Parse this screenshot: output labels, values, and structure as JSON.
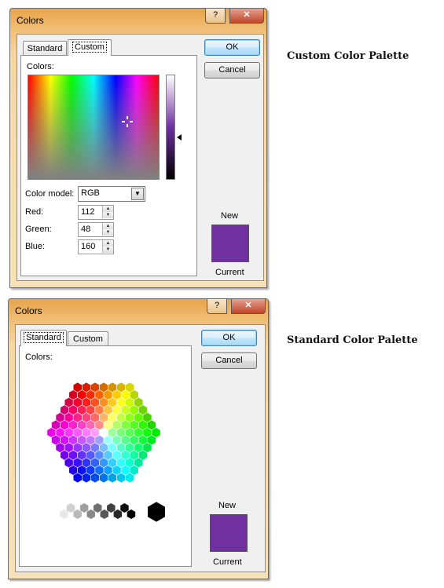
{
  "custom_dialog": {
    "title": "Colors",
    "help_label": "?",
    "close_label": "✕",
    "tabs": [
      {
        "label": "Standard"
      },
      {
        "label": "Custom"
      }
    ],
    "active_tab": "Custom",
    "colors_label": "Colors:",
    "color_model_label": "Color model:",
    "color_model_value": "RGB",
    "red_label": "Red:",
    "red_value": "112",
    "green_label": "Green:",
    "green_value": "48",
    "blue_label": "Blue:",
    "blue_value": "160",
    "ok_label": "OK",
    "cancel_label": "Cancel",
    "new_label": "New",
    "current_label": "Current",
    "new_color": "#7030a0",
    "current_color": "#7030a0"
  },
  "standard_dialog": {
    "title": "Colors",
    "help_label": "?",
    "close_label": "✕",
    "tabs": [
      {
        "label": "Standard"
      },
      {
        "label": "Custom"
      }
    ],
    "active_tab": "Standard",
    "colors_label": "Colors:",
    "ok_label": "OK",
    "cancel_label": "Cancel",
    "new_label": "New",
    "current_label": "Current",
    "new_color": "#7030a0",
    "current_color": "#7030a0"
  },
  "captions": {
    "custom": "Custom Color Palette",
    "standard": "Standard Color Palette"
  },
  "greys": [
    "#ffffff",
    "#e8e8e8",
    "#d0d0d0",
    "#b8b8b8",
    "#a0a0a0",
    "#888888",
    "#707070",
    "#585858",
    "#404040",
    "#282828",
    "#101010",
    "#000000"
  ]
}
